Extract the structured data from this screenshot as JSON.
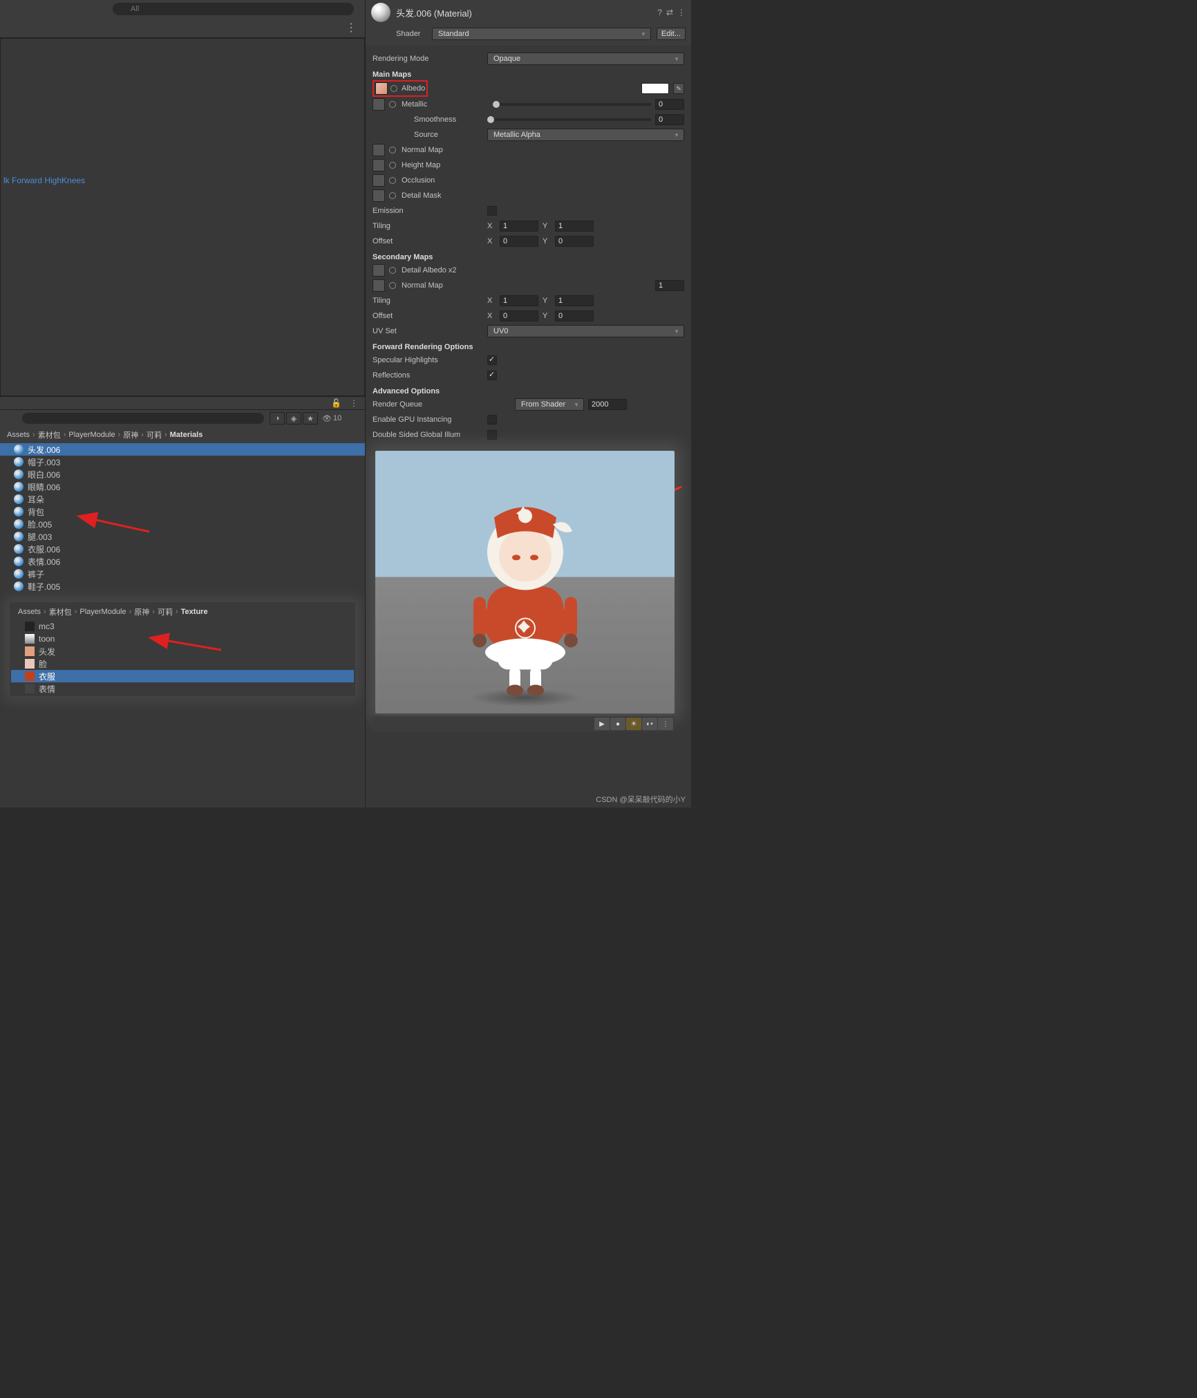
{
  "search": {
    "placeholder": "All"
  },
  "left_pane": {
    "link": "lk Forward HighKnees"
  },
  "project": {
    "hidden_count": "10",
    "breadcrumb1": [
      "Assets",
      "素材包",
      "PlayerModule",
      "原神",
      "可莉",
      "Materials"
    ],
    "breadcrumb2": [
      "Assets",
      "素材包",
      "PlayerModule",
      "原神",
      "可莉",
      "Texture"
    ],
    "materials": [
      {
        "name": "头发.006",
        "selected": true
      },
      {
        "name": "帽子.003"
      },
      {
        "name": "眼白.006"
      },
      {
        "name": "眼睛.006"
      },
      {
        "name": "耳朵"
      },
      {
        "name": "背包"
      },
      {
        "name": "脸.005"
      },
      {
        "name": "腿.003"
      },
      {
        "name": "衣服.006"
      },
      {
        "name": "表情.006"
      },
      {
        "name": "裤子"
      },
      {
        "name": "鞋子.005"
      }
    ],
    "textures": [
      {
        "name": "mc3",
        "color": "#222"
      },
      {
        "name": "toon",
        "color": "linear-gradient(#fff,#888)"
      },
      {
        "name": "头发",
        "color": "#e0a080"
      },
      {
        "name": "脸",
        "color": "#e8c8b8"
      },
      {
        "name": "衣服",
        "selected": true,
        "color": "#c04020"
      },
      {
        "name": "表情",
        "color": "#444"
      }
    ]
  },
  "inspector": {
    "title": "头发.006 (Material)",
    "shader_label": "Shader",
    "shader_value": "Standard",
    "edit": "Edit...",
    "rendering_mode": {
      "label": "Rendering Mode",
      "value": "Opaque"
    },
    "main_maps": "Main Maps",
    "albedo": "Albedo",
    "metallic": {
      "label": "Metallic",
      "value": "0"
    },
    "smoothness": {
      "label": "Smoothness",
      "value": "0"
    },
    "source": {
      "label": "Source",
      "value": "Metallic Alpha"
    },
    "normal_map": "Normal Map",
    "height_map": "Height Map",
    "occlusion": "Occlusion",
    "detail_mask": "Detail Mask",
    "emission": "Emission",
    "tiling": "Tiling",
    "offset": "Offset",
    "tiling1": {
      "x": "1",
      "y": "1"
    },
    "offset1": {
      "x": "0",
      "y": "0"
    },
    "secondary_maps": "Secondary Maps",
    "detail_albedo": "Detail Albedo x2",
    "normal_map2": {
      "label": "Normal Map",
      "value": "1"
    },
    "tiling2": {
      "x": "1",
      "y": "1"
    },
    "offset2": {
      "x": "0",
      "y": "0"
    },
    "uv_set": {
      "label": "UV Set",
      "value": "UV0"
    },
    "fwd_opts": "Forward Rendering Options",
    "spec_hl": "Specular Highlights",
    "reflections": "Reflections",
    "adv_opts": "Advanced Options",
    "render_queue": {
      "label": "Render Queue",
      "dd": "From Shader",
      "value": "2000"
    },
    "gpu_inst": "Enable GPU Instancing",
    "dbl_sided": "Double Sided Global Illum"
  },
  "watermark": "CSDN @呆呆敲代码的小Y"
}
